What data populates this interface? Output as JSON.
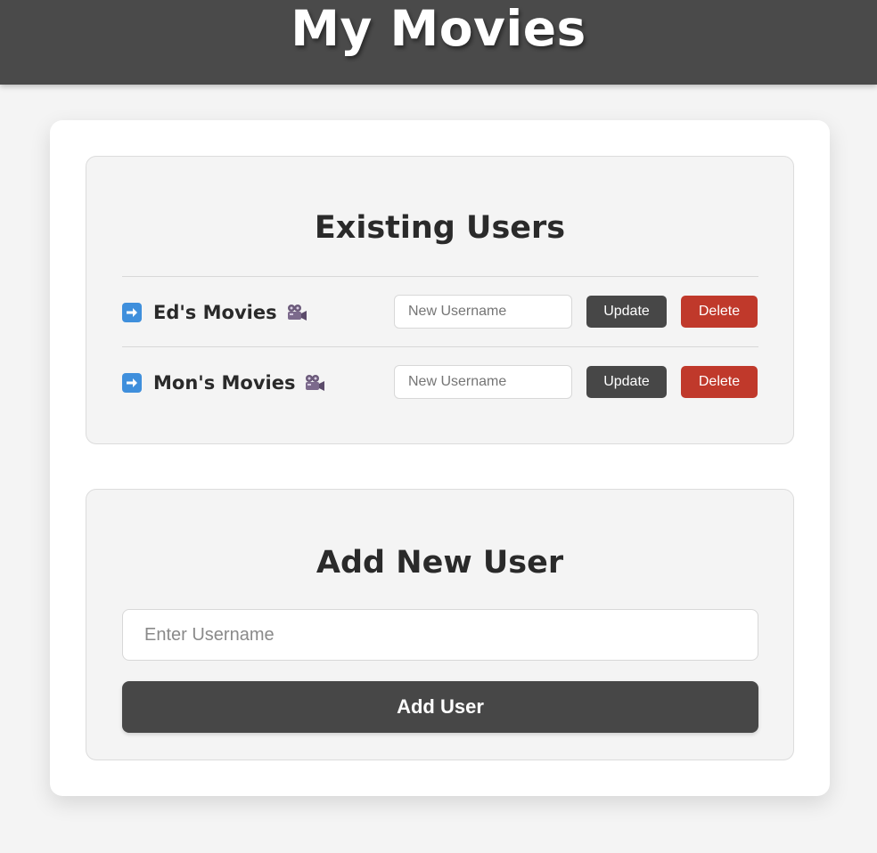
{
  "header": {
    "title": "My Movies"
  },
  "existing_users": {
    "title": "Existing Users",
    "users": [
      {
        "label": "Ed's Movies",
        "input_placeholder": "New Username",
        "input_value": "",
        "update_label": "Update",
        "delete_label": "Delete"
      },
      {
        "label": "Mon's Movies",
        "input_placeholder": "New Username",
        "input_value": "",
        "update_label": "Update",
        "delete_label": "Delete"
      }
    ]
  },
  "add_user": {
    "title": "Add New User",
    "input_placeholder": "Enter Username",
    "input_value": "",
    "button_label": "Add User"
  },
  "icons": {
    "row_prefix": "right-arrow-icon",
    "row_suffix": "movie-camera-icon"
  },
  "colors": {
    "header_bg": "#4a4a4a",
    "update_button": "#474747",
    "delete_button": "#c0392b",
    "add_button": "#474747"
  }
}
